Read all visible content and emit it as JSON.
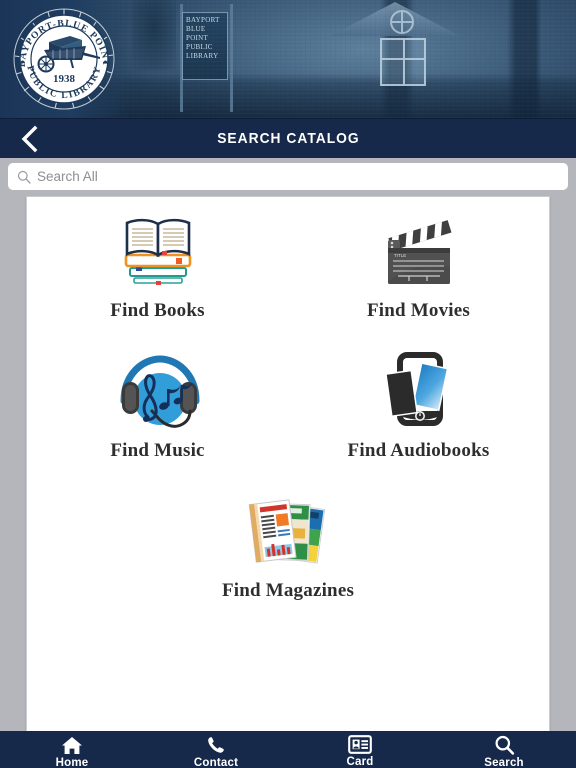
{
  "header": {
    "logo": {
      "top_arc_text": "BAYPORT-BLUE POINT",
      "bottom_arc_text": "PUBLIC LIBRARY",
      "year": "1938",
      "emblem": "wheelbarrow-with-books-icon"
    },
    "banner_sign_text": "BAYPORT BLUE POINT PUBLIC LIBRARY",
    "banner_image": "library-building-photo"
  },
  "navbar": {
    "title": "SEARCH CATALOG",
    "back_icon": "chevron-left-icon"
  },
  "search": {
    "placeholder": "Search All",
    "value": "",
    "icon": "search-icon"
  },
  "tiles": [
    {
      "label": "Find Books",
      "icon": "open-book-on-stack-icon"
    },
    {
      "label": "Find Movies",
      "icon": "clapperboard-icon"
    },
    {
      "label": "Find Music",
      "icon": "headphones-music-notes-icon"
    },
    {
      "label": "Find Audiobooks",
      "icon": "tablet-with-book-icon"
    },
    {
      "label": "Find Magazines",
      "icon": "magazines-stack-icon"
    }
  ],
  "tabbar": [
    {
      "label": "Home",
      "icon": "home-icon"
    },
    {
      "label": "Contact",
      "icon": "phone-icon"
    },
    {
      "label": "Card",
      "icon": "id-card-icon"
    },
    {
      "label": "Search",
      "icon": "search-icon"
    }
  ],
  "colors": {
    "navy": "#17294a",
    "page_bg": "#b4b6bb",
    "card_bg": "#ffffff",
    "label_text": "#2e2e2e",
    "placeholder_text": "#8e8e93"
  }
}
